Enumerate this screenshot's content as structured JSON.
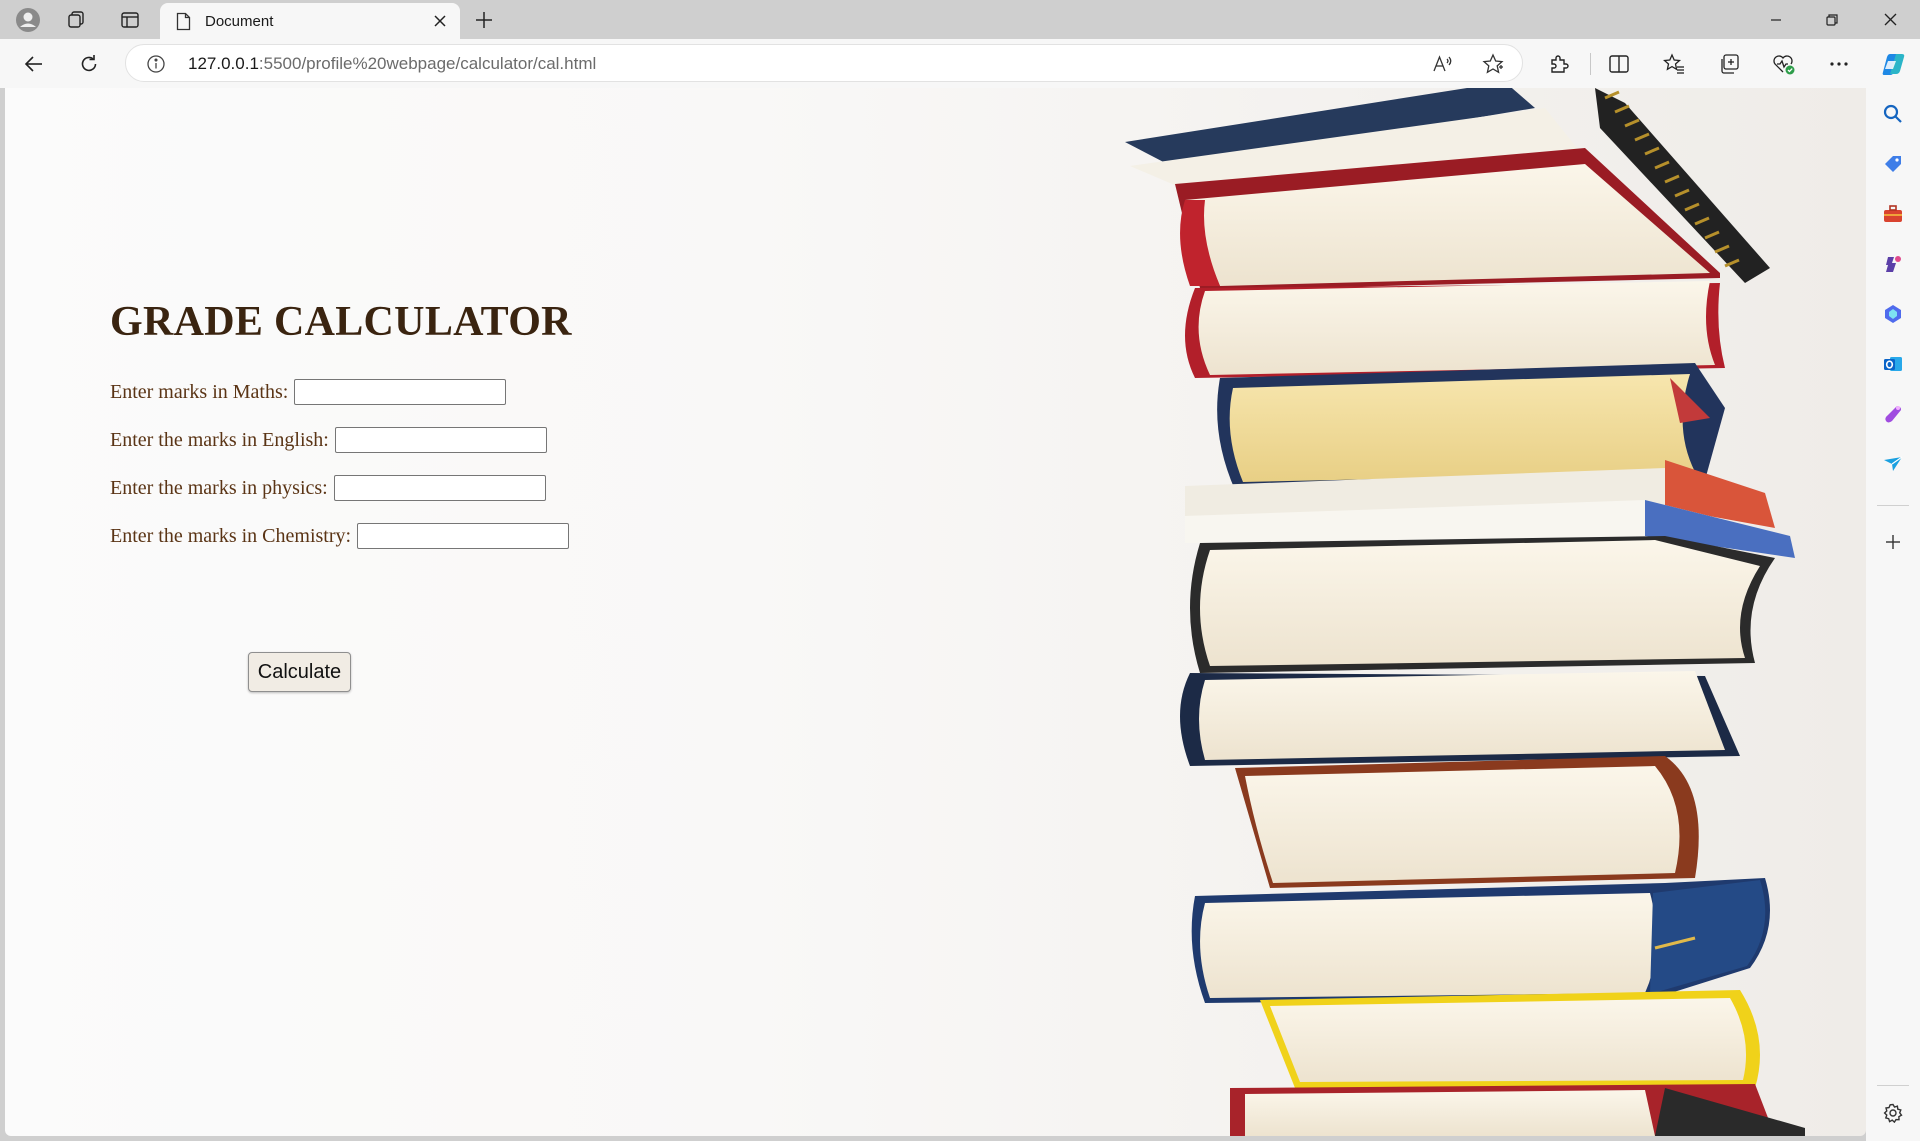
{
  "browser": {
    "tab": {
      "title": "Document"
    },
    "address": {
      "host": "127.0.0.1",
      "rest": ":5500/profile%20webpage/calculator/cal.html"
    }
  },
  "page": {
    "title": "GRADE CALCULATOR",
    "fields": [
      {
        "label": "Enter marks in Maths:",
        "value": ""
      },
      {
        "label": "Enter the marks in English:",
        "value": ""
      },
      {
        "label": "Enter the marks in physics:",
        "value": ""
      },
      {
        "label": "Enter the marks in Chemistry:",
        "value": ""
      }
    ],
    "button_label": "Calculate"
  },
  "colors": {
    "heading": "#3a2410",
    "label": "#5a3415",
    "browser_chrome": "#cfcfcf",
    "toolbar": "#f7f7f7",
    "copilot_accent": "#1e88e5"
  },
  "icons": {
    "tabstrip": [
      "profile-icon",
      "workspaces-icon",
      "tab-actions-icon",
      "page-icon",
      "close-icon",
      "plus-icon"
    ],
    "toolbar": [
      "back-icon",
      "refresh-icon",
      "info-icon",
      "read-aloud-icon",
      "favorite-star-icon",
      "extensions-icon",
      "split-screen-icon",
      "favorites-icon",
      "collections-icon",
      "browser-essentials-icon",
      "more-icon",
      "copilot-icon"
    ],
    "sidebar": [
      "search-icon",
      "shopping-tag-icon",
      "tools-briefcase-icon",
      "games-icon",
      "microsoft-365-icon",
      "outlook-icon",
      "designer-icon",
      "drop-icon",
      "plus-icon",
      "settings-gear-icon"
    ]
  }
}
